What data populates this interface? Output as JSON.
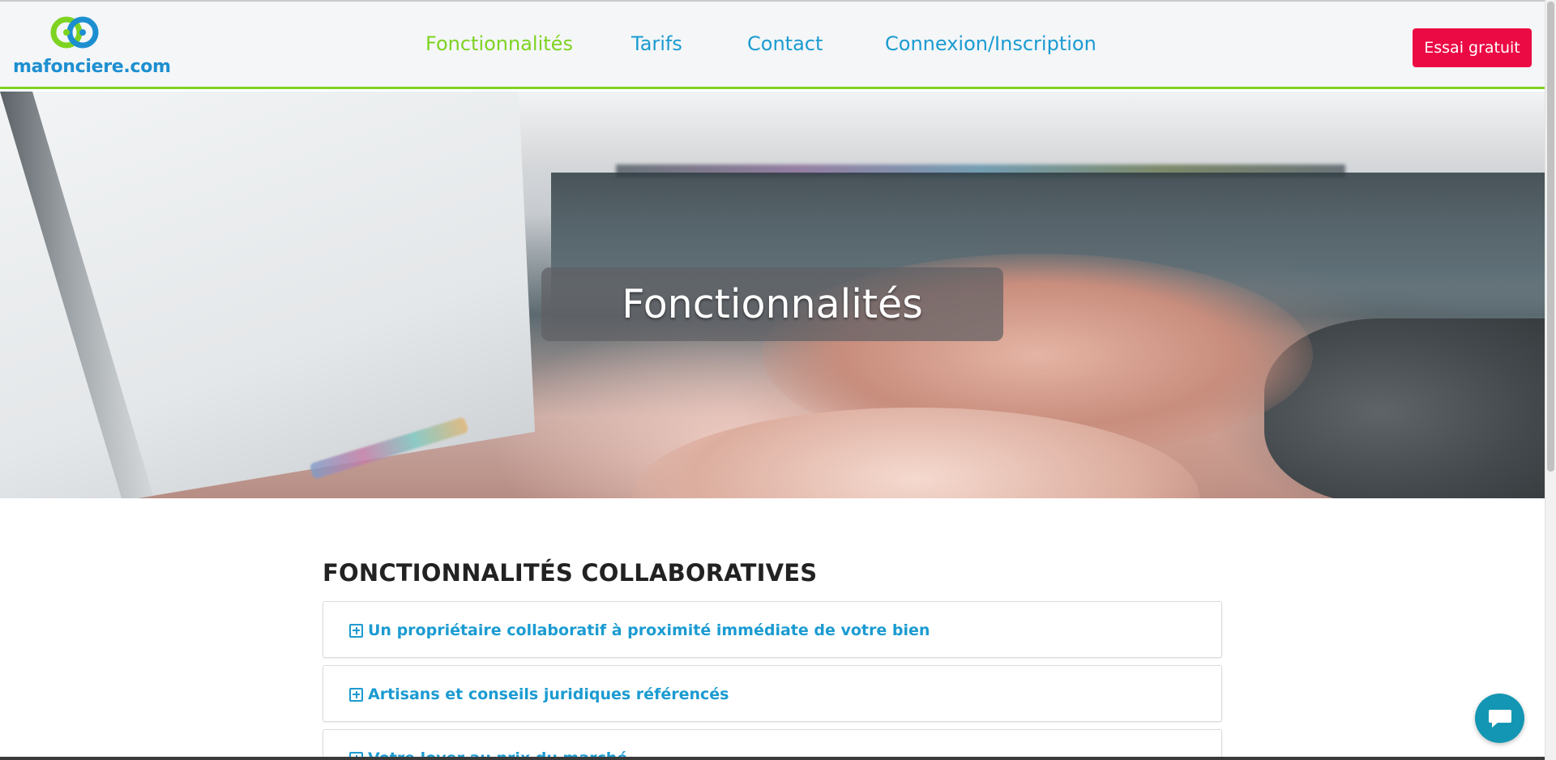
{
  "brand": {
    "name": "mafonciere.com",
    "logo_icon": "linked-circles-logo",
    "colors": {
      "blue": "#1d8fd0",
      "green": "#7ed321"
    }
  },
  "nav": {
    "items": [
      {
        "label": "Fonctionnalités",
        "active": true
      },
      {
        "label": "Tarifs",
        "active": false
      },
      {
        "label": "Contact",
        "active": false
      },
      {
        "label": "Connexion/Inscription",
        "active": false
      }
    ],
    "cta_label": "Essai gratuit",
    "cta_color": "#eb0a44"
  },
  "hero": {
    "title": "Fonctionnalités",
    "background_icon": "laptop-typing-photo"
  },
  "section": {
    "title": "FONCTIONNALITÉS COLLABORATIVES",
    "accordion": [
      {
        "label": "Un propriétaire collaboratif à proximité immédiate de votre bien",
        "icon": "plus-square-icon"
      },
      {
        "label": "Artisans et conseils juridiques référencés",
        "icon": "plus-square-icon"
      },
      {
        "label": "Votre loyer au prix du marché",
        "icon": "plus-square-icon"
      }
    ]
  },
  "chat_widget": {
    "icon": "chat-bubble-icon",
    "color": "#1396b3"
  }
}
